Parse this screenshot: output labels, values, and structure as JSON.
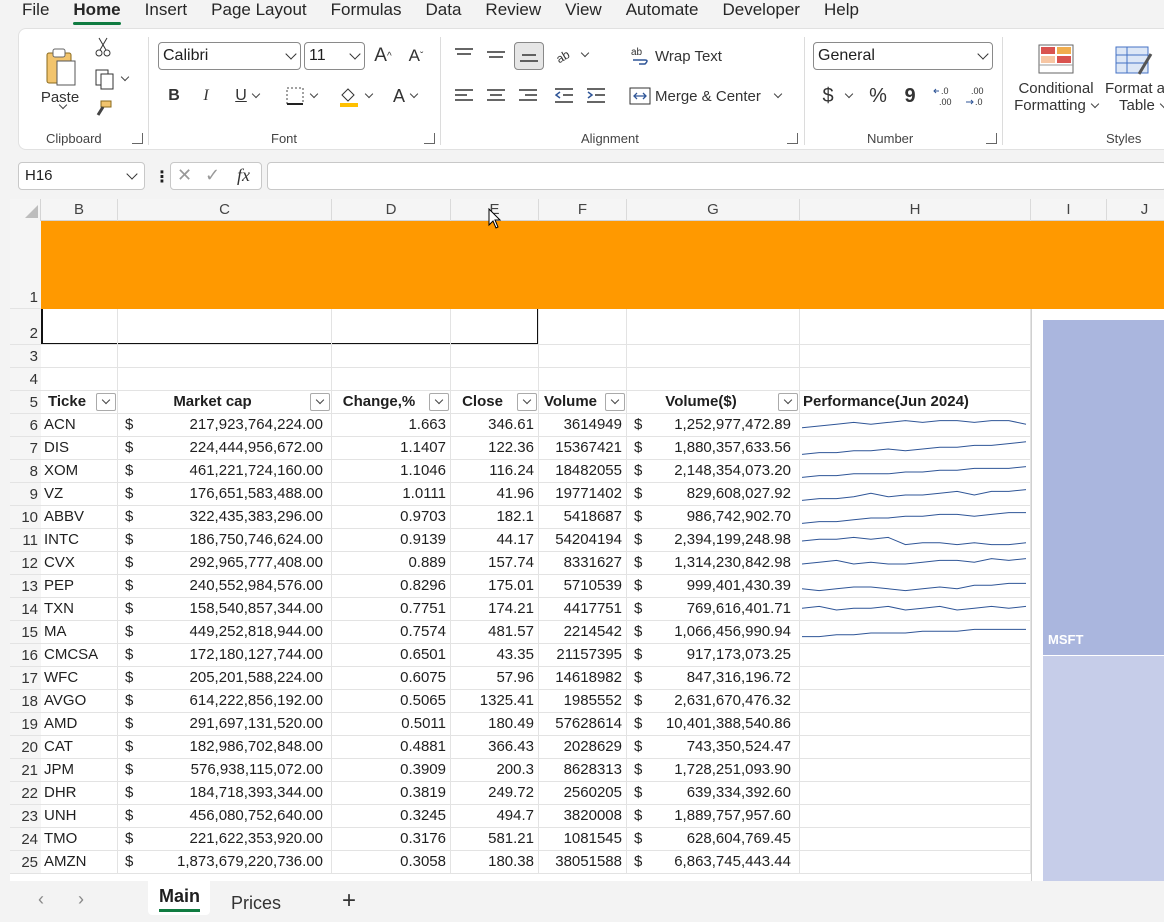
{
  "menu": [
    "File",
    "Home",
    "Insert",
    "Page Layout",
    "Formulas",
    "Data",
    "Review",
    "View",
    "Automate",
    "Developer",
    "Help"
  ],
  "ribbon": {
    "clipboard": {
      "label": "Clipboard",
      "paste": "Paste"
    },
    "font": {
      "label": "Font",
      "name": "Calibri",
      "size": "11",
      "grow": "A",
      "shrink": "A",
      "bold": "B",
      "italic": "I",
      "underline": "U",
      "color_a": "A"
    },
    "alignment": {
      "label": "Alignment",
      "wrap": "Wrap Text",
      "merge": "Merge & Center"
    },
    "number": {
      "label": "Number",
      "format": "General",
      "currency": "$",
      "percent": "%",
      "comma": "9",
      "inc_dec": "←.0 .00",
      "dec_dec": ".00 →.0"
    },
    "styles": {
      "label": "Styles",
      "cond": "Conditional",
      "cond2": "Formatting",
      "fmt": "Format a",
      "fmt2": "Table"
    }
  },
  "formula_bar": {
    "name_box": "H16",
    "fx": "fx",
    "formula": ""
  },
  "columns": [
    "B",
    "C",
    "D",
    "E",
    "F",
    "G",
    "H",
    "I",
    "J"
  ],
  "table_headers": [
    "Ticke",
    "Market cap",
    "Change,%",
    "Close",
    "Volume",
    "Volume($)",
    "Performance(Jun 2024)"
  ],
  "rows": [
    {
      "row": "6",
      "ticker": "ACN",
      "mcap": "217,923,764,224.00",
      "change": "1.663",
      "close": "346.61",
      "volume": "3614949",
      "vol_usd": "1,252,977,472.89"
    },
    {
      "row": "7",
      "ticker": "DIS",
      "mcap": "224,444,956,672.00",
      "change": "1.1407",
      "close": "122.36",
      "volume": "15367421",
      "vol_usd": "1,880,357,633.56"
    },
    {
      "row": "8",
      "ticker": "XOM",
      "mcap": "461,221,724,160.00",
      "change": "1.1046",
      "close": "116.24",
      "volume": "18482055",
      "vol_usd": "2,148,354,073.20"
    },
    {
      "row": "9",
      "ticker": "VZ",
      "mcap": "176,651,583,488.00",
      "change": "1.0111",
      "close": "41.96",
      "volume": "19771402",
      "vol_usd": "829,608,027.92"
    },
    {
      "row": "10",
      "ticker": "ABBV",
      "mcap": "322,435,383,296.00",
      "change": "0.9703",
      "close": "182.1",
      "volume": "5418687",
      "vol_usd": "986,742,902.70"
    },
    {
      "row": "11",
      "ticker": "INTC",
      "mcap": "186,750,746,624.00",
      "change": "0.9139",
      "close": "44.17",
      "volume": "54204194",
      "vol_usd": "2,394,199,248.98"
    },
    {
      "row": "12",
      "ticker": "CVX",
      "mcap": "292,965,777,408.00",
      "change": "0.889",
      "close": "157.74",
      "volume": "8331627",
      "vol_usd": "1,314,230,842.98"
    },
    {
      "row": "13",
      "ticker": "PEP",
      "mcap": "240,552,984,576.00",
      "change": "0.8296",
      "close": "175.01",
      "volume": "5710539",
      "vol_usd": "999,401,430.39"
    },
    {
      "row": "14",
      "ticker": "TXN",
      "mcap": "158,540,857,344.00",
      "change": "0.7751",
      "close": "174.21",
      "volume": "4417751",
      "vol_usd": "769,616,401.71"
    },
    {
      "row": "15",
      "ticker": "MA",
      "mcap": "449,252,818,944.00",
      "change": "0.7574",
      "close": "481.57",
      "volume": "2214542",
      "vol_usd": "1,066,456,990.94"
    },
    {
      "row": "16",
      "ticker": "CMCSA",
      "mcap": "172,180,127,744.00",
      "change": "0.6501",
      "close": "43.35",
      "volume": "21157395",
      "vol_usd": "917,173,073.25"
    },
    {
      "row": "17",
      "ticker": "WFC",
      "mcap": "205,201,588,224.00",
      "change": "0.6075",
      "close": "57.96",
      "volume": "14618982",
      "vol_usd": "847,316,196.72"
    },
    {
      "row": "18",
      "ticker": "AVGO",
      "mcap": "614,222,856,192.00",
      "change": "0.5065",
      "close": "1325.41",
      "volume": "1985552",
      "vol_usd": "2,631,670,476.32"
    },
    {
      "row": "19",
      "ticker": "AMD",
      "mcap": "291,697,131,520.00",
      "change": "0.5011",
      "close": "180.49",
      "volume": "57628614",
      "vol_usd": "10,401,388,540.86"
    },
    {
      "row": "20",
      "ticker": "CAT",
      "mcap": "182,986,702,848.00",
      "change": "0.4881",
      "close": "366.43",
      "volume": "2028629",
      "vol_usd": "743,350,524.47"
    },
    {
      "row": "21",
      "ticker": "JPM",
      "mcap": "576,938,115,072.00",
      "change": "0.3909",
      "close": "200.3",
      "volume": "8628313",
      "vol_usd": "1,728,251,093.90"
    },
    {
      "row": "22",
      "ticker": "DHR",
      "mcap": "184,718,393,344.00",
      "change": "0.3819",
      "close": "249.72",
      "volume": "2560205",
      "vol_usd": "639,334,392.60"
    },
    {
      "row": "23",
      "ticker": "UNH",
      "mcap": "456,080,752,640.00",
      "change": "0.3245",
      "close": "494.7",
      "volume": "3820008",
      "vol_usd": "1,889,757,957.60"
    },
    {
      "row": "24",
      "ticker": "TMO",
      "mcap": "221,622,353,920.00",
      "change": "0.3176",
      "close": "581.21",
      "volume": "1081545",
      "vol_usd": "628,604,769.45"
    },
    {
      "row": "25",
      "ticker": "AMZN",
      "mcap": "1,873,679,220,736.00",
      "change": "0.3058",
      "close": "180.38",
      "volume": "38051588",
      "vol_usd": "6,863,745,443.44"
    }
  ],
  "currency_symbol": "$",
  "treemap_label": "MSFT",
  "sheet_tabs": [
    "Main",
    "Prices"
  ],
  "colors": {
    "banner": "#ff9900",
    "treemap_top": "#aab6de",
    "treemap_bottom": "#c6cde9",
    "accent": "#107c41",
    "sparkline": "#2f5597"
  }
}
